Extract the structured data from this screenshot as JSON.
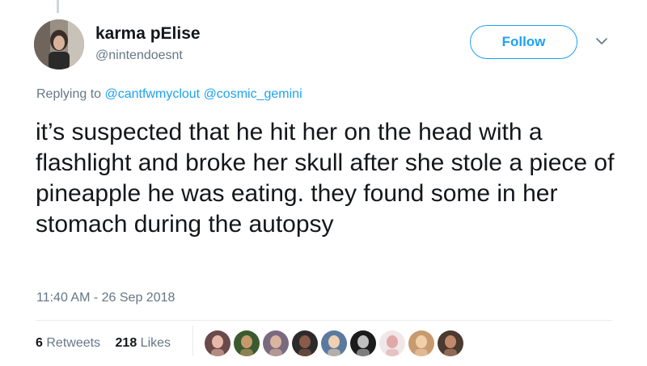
{
  "tweet": {
    "author": {
      "display_name": "karma pElise",
      "handle": "@nintendoesnt"
    },
    "follow_label": "Follow",
    "reply_prefix": "Replying to",
    "reply_to": [
      "@cantfwmyclout",
      "@cosmic_gemini"
    ],
    "text": "it’s suspected that he hit her on the head with a flashlight and broke her skull after she stole a piece of pineapple he was eating. they found some in her stomach during the autopsy",
    "timestamp": "11:40 AM - 26 Sep 2018",
    "retweets": {
      "count": "6",
      "label": "Retweets"
    },
    "likes": {
      "count": "218",
      "label": "Likes"
    }
  },
  "colors": {
    "accent": "#1da1f2",
    "secondary_text": "#657786",
    "primary_text": "#14171a",
    "divider": "#e6ecf0"
  },
  "icons": {
    "menu": "chevron-down-icon"
  },
  "liker_avatars": [
    {
      "bg": "#6a4a4a",
      "face": "#e8b8a8"
    },
    {
      "bg": "#3b5a2f",
      "face": "#c49a6c"
    },
    {
      "bg": "#7a6a80",
      "face": "#d9b5a0"
    },
    {
      "bg": "#2b2b2b",
      "face": "#8a5a4a"
    },
    {
      "bg": "#5a7aa0",
      "face": "#f0d0b0"
    },
    {
      "bg": "#1c1c1c",
      "face": "#bfbfbf"
    },
    {
      "bg": "#f0e8e8",
      "face": "#e0a8a8"
    },
    {
      "bg": "#c89a70",
      "face": "#f2cfa8"
    },
    {
      "bg": "#4a3a30",
      "face": "#c08a6a"
    }
  ]
}
